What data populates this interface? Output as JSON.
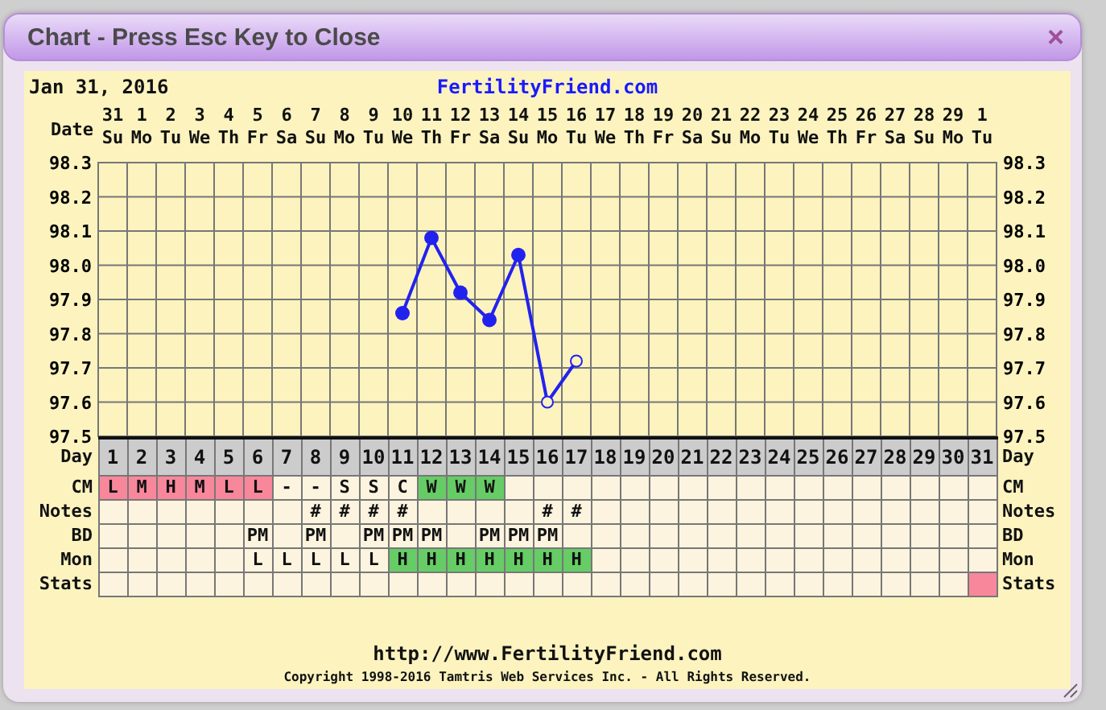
{
  "window": {
    "title": "Chart - Press Esc Key to Close",
    "close": "×"
  },
  "header": {
    "date": "Jan 31, 2016",
    "site_link": "FertilityFriend.com"
  },
  "dates": {
    "label": "Date",
    "columns": [
      {
        "day": "31",
        "weekday": "Su"
      },
      {
        "day": "1",
        "weekday": "Mo"
      },
      {
        "day": "2",
        "weekday": "Tu"
      },
      {
        "day": "3",
        "weekday": "We"
      },
      {
        "day": "4",
        "weekday": "Th"
      },
      {
        "day": "5",
        "weekday": "Fr"
      },
      {
        "day": "6",
        "weekday": "Sa"
      },
      {
        "day": "7",
        "weekday": "Su"
      },
      {
        "day": "8",
        "weekday": "Mo"
      },
      {
        "day": "9",
        "weekday": "Tu"
      },
      {
        "day": "10",
        "weekday": "We"
      },
      {
        "day": "11",
        "weekday": "Th"
      },
      {
        "day": "12",
        "weekday": "Fr"
      },
      {
        "day": "13",
        "weekday": "Sa"
      },
      {
        "day": "14",
        "weekday": "Su"
      },
      {
        "day": "15",
        "weekday": "Mo"
      },
      {
        "day": "16",
        "weekday": "Tu"
      },
      {
        "day": "17",
        "weekday": "We"
      },
      {
        "day": "18",
        "weekday": "Th"
      },
      {
        "day": "19",
        "weekday": "Fr"
      },
      {
        "day": "20",
        "weekday": "Sa"
      },
      {
        "day": "21",
        "weekday": "Su"
      },
      {
        "day": "22",
        "weekday": "Mo"
      },
      {
        "day": "23",
        "weekday": "Tu"
      },
      {
        "day": "24",
        "weekday": "We"
      },
      {
        "day": "25",
        "weekday": "Th"
      },
      {
        "day": "26",
        "weekday": "Fr"
      },
      {
        "day": "27",
        "weekday": "Sa"
      },
      {
        "day": "28",
        "weekday": "Su"
      },
      {
        "day": "29",
        "weekday": "Mo"
      },
      {
        "day": "1",
        "weekday": "Tu"
      }
    ]
  },
  "chart": {
    "chart_data": {
      "type": "line",
      "grid": true,
      "series": [
        {
          "color": "#2222ee",
          "marker": "circle",
          "values": [
            null,
            null,
            null,
            null,
            null,
            null,
            null,
            null,
            null,
            null,
            97.86,
            98.08,
            97.92,
            97.84,
            98.03,
            97.6,
            97.72,
            null,
            null,
            null,
            null,
            null,
            null,
            null,
            null,
            null,
            null,
            null,
            null,
            null,
            null
          ]
        }
      ],
      "ylim": [
        97.5,
        98.3
      ],
      "yticks": [
        {
          "value": 98.3,
          "label": "98.3"
        },
        {
          "value": 98.2,
          "label": "98.2"
        },
        {
          "value": 98.1,
          "label": "98.1"
        },
        {
          "value": 98.0,
          "label": "98.0"
        },
        {
          "value": 97.9,
          "label": "97.9"
        },
        {
          "value": 97.8,
          "label": "97.8"
        },
        {
          "value": 97.7,
          "label": "97.7"
        },
        {
          "value": 97.6,
          "label": "97.6"
        },
        {
          "value": 97.5,
          "label": "97.5"
        }
      ]
    },
    "points": [
      {
        "hollow": false
      },
      {
        "hollow": false
      },
      {
        "hollow": false
      },
      {
        "hollow": false
      },
      {
        "hollow": false
      },
      {
        "hollow": true
      },
      {
        "hollow": true
      }
    ],
    "right_ticks": [
      "98.3",
      "98.2",
      "98.1",
      "98.0",
      "97.9",
      "97.8",
      "97.7",
      "97.6",
      "97.5"
    ]
  },
  "table": {
    "rows": [
      {
        "label": "Day",
        "label_right": "Day",
        "kind": "header",
        "cells": [
          {
            "text": "1"
          },
          {
            "text": "2"
          },
          {
            "text": "3"
          },
          {
            "text": "4"
          },
          {
            "text": "5"
          },
          {
            "text": "6"
          },
          {
            "text": "7"
          },
          {
            "text": "8"
          },
          {
            "text": "9"
          },
          {
            "text": "10"
          },
          {
            "text": "11"
          },
          {
            "text": "12"
          },
          {
            "text": "13"
          },
          {
            "text": "14"
          },
          {
            "text": "15"
          },
          {
            "text": "16"
          },
          {
            "text": "17"
          },
          {
            "text": "18"
          },
          {
            "text": "19"
          },
          {
            "text": "20"
          },
          {
            "text": "21"
          },
          {
            "text": "22"
          },
          {
            "text": "23"
          },
          {
            "text": "24"
          },
          {
            "text": "25"
          },
          {
            "text": "26"
          },
          {
            "text": "27"
          },
          {
            "text": "28"
          },
          {
            "text": "29"
          },
          {
            "text": "30"
          },
          {
            "text": "31"
          }
        ]
      },
      {
        "label": "CM",
        "label_right": "CM",
        "kind": "data",
        "cells": [
          {
            "text": "L",
            "color": "#f8879c"
          },
          {
            "text": "M",
            "color": "#f8879c"
          },
          {
            "text": "H",
            "color": "#f8879c"
          },
          {
            "text": "M",
            "color": "#f8879c"
          },
          {
            "text": "L",
            "color": "#f8879c"
          },
          {
            "text": "L",
            "color": "#f8879c"
          },
          {
            "text": "-"
          },
          {
            "text": "-"
          },
          {
            "text": "S"
          },
          {
            "text": "S"
          },
          {
            "text": "C"
          },
          {
            "text": "W",
            "color": "#66cc66"
          },
          {
            "text": "W",
            "color": "#66cc66"
          },
          {
            "text": "W",
            "color": "#66cc66"
          },
          null,
          null,
          null,
          null,
          null,
          null,
          null,
          null,
          null,
          null,
          null,
          null,
          null,
          null,
          null,
          null,
          null
        ]
      },
      {
        "label": "Notes",
        "label_right": "Notes",
        "kind": "data",
        "cells": [
          null,
          null,
          null,
          null,
          null,
          null,
          null,
          {
            "text": "#"
          },
          {
            "text": "#"
          },
          {
            "text": "#"
          },
          {
            "text": "#"
          },
          null,
          null,
          null,
          null,
          {
            "text": "#"
          },
          {
            "text": "#"
          },
          null,
          null,
          null,
          null,
          null,
          null,
          null,
          null,
          null,
          null,
          null,
          null,
          null,
          null
        ]
      },
      {
        "label": "BD",
        "label_right": "BD",
        "kind": "data",
        "cells": [
          null,
          null,
          null,
          null,
          null,
          {
            "text": "PM"
          },
          null,
          {
            "text": "PM"
          },
          null,
          {
            "text": "PM"
          },
          {
            "text": "PM"
          },
          {
            "text": "PM"
          },
          null,
          {
            "text": "PM"
          },
          {
            "text": "PM"
          },
          {
            "text": "PM"
          },
          null,
          null,
          null,
          null,
          null,
          null,
          null,
          null,
          null,
          null,
          null,
          null,
          null,
          null,
          null
        ]
      },
      {
        "label": "Mon",
        "label_right": "Mon",
        "kind": "data",
        "cells": [
          null,
          null,
          null,
          null,
          null,
          {
            "text": "L"
          },
          {
            "text": "L"
          },
          {
            "text": "L"
          },
          {
            "text": "L"
          },
          {
            "text": "L"
          },
          {
            "text": "H",
            "color": "#66cc66"
          },
          {
            "text": "H",
            "color": "#66cc66"
          },
          {
            "text": "H",
            "color": "#66cc66"
          },
          {
            "text": "H",
            "color": "#66cc66"
          },
          {
            "text": "H",
            "color": "#66cc66"
          },
          {
            "text": "H",
            "color": "#66cc66"
          },
          {
            "text": "H",
            "color": "#66cc66"
          },
          null,
          null,
          null,
          null,
          null,
          null,
          null,
          null,
          null,
          null,
          null,
          null,
          null,
          null
        ]
      },
      {
        "label": "Stats",
        "label_right": "Stats",
        "kind": "data",
        "cells": [
          null,
          null,
          null,
          null,
          null,
          null,
          null,
          null,
          null,
          null,
          null,
          null,
          null,
          null,
          null,
          null,
          null,
          null,
          null,
          null,
          null,
          null,
          null,
          null,
          null,
          null,
          null,
          null,
          null,
          null,
          {
            "color": "#f8879c"
          }
        ]
      }
    ]
  },
  "footer": {
    "url": "http://www.FertilityFriend.com",
    "copyright": "Copyright 1998-2016 Tamtris Web Services Inc. - All Rights Reserved."
  }
}
